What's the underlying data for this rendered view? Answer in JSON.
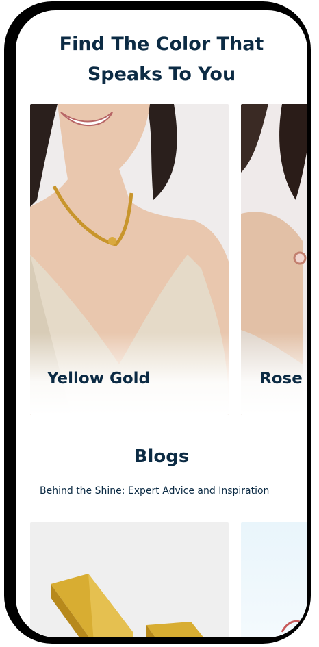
{
  "section": {
    "title_line1": "Find The Color That",
    "title_line2": "Speaks To You"
  },
  "color_cards": [
    {
      "label": "Yellow Gold",
      "image": "model-gold-necklace"
    },
    {
      "label": "Rose Gold",
      "image": "model-rose-gold-bracelet"
    }
  ],
  "blogs": {
    "title": "Blogs",
    "subtitle": "Behind the Shine: Expert Advice and Inspiration",
    "cards": [
      {
        "image": "gold-bars"
      },
      {
        "image": "light-blue-jewelry"
      }
    ]
  },
  "colors": {
    "heading": "#0c2b44",
    "frame": "#000000",
    "gold": "#d4a53a"
  }
}
